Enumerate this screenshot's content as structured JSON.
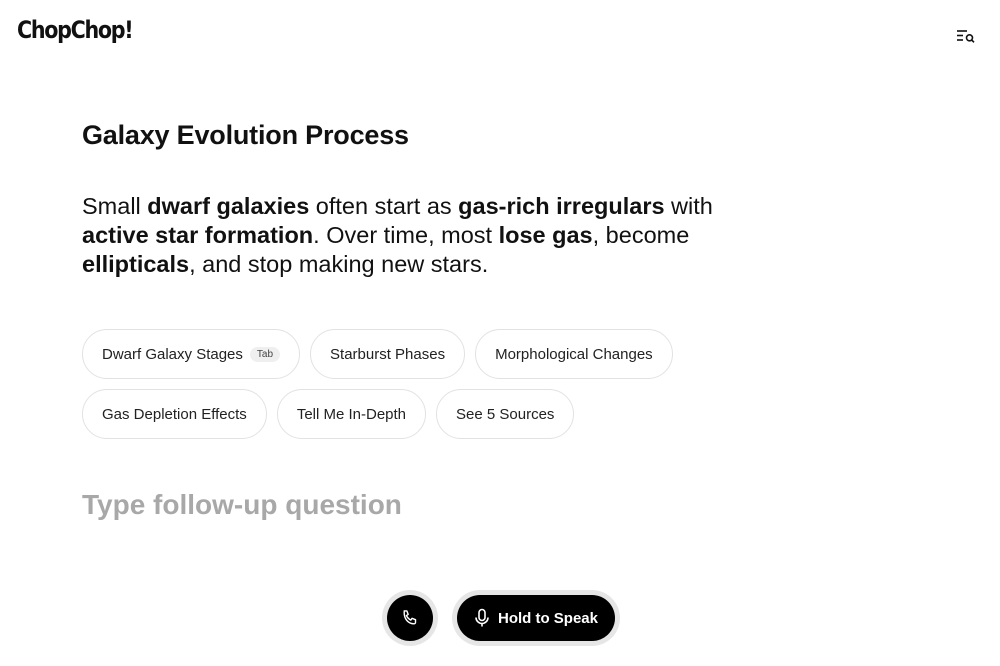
{
  "header": {
    "logo": "ChopChop!",
    "history_icon": "search-list-icon"
  },
  "main": {
    "title": "Galaxy Evolution Process",
    "answer": {
      "parts": [
        {
          "text": "Small ",
          "bold": false
        },
        {
          "text": "dwarf galaxies",
          "bold": true
        },
        {
          "text": " often start as ",
          "bold": false
        },
        {
          "text": "gas-rich irregulars",
          "bold": true
        },
        {
          "text": " with ",
          "bold": false
        },
        {
          "text": "active star formation",
          "bold": true
        },
        {
          "text": ". Over time, most ",
          "bold": false
        },
        {
          "text": "lose gas",
          "bold": true
        },
        {
          "text": ", become ",
          "bold": false
        },
        {
          "text": "ellipticals",
          "bold": true
        },
        {
          "text": ", and stop making new stars.",
          "bold": false
        }
      ]
    },
    "suggestions": [
      {
        "label": "Dwarf Galaxy Stages",
        "shortcut": "Tab"
      },
      {
        "label": "Starburst Phases"
      },
      {
        "label": "Morphological Changes"
      },
      {
        "label": "Gas Depletion Effects"
      },
      {
        "label": "Tell Me In-Depth"
      },
      {
        "label": "See 5 Sources"
      }
    ],
    "followup_placeholder": "Type follow-up question",
    "followup_value": ""
  },
  "controls": {
    "call_icon": "phone-icon",
    "mic_icon": "microphone-icon",
    "speak_label": "Hold to Speak"
  }
}
